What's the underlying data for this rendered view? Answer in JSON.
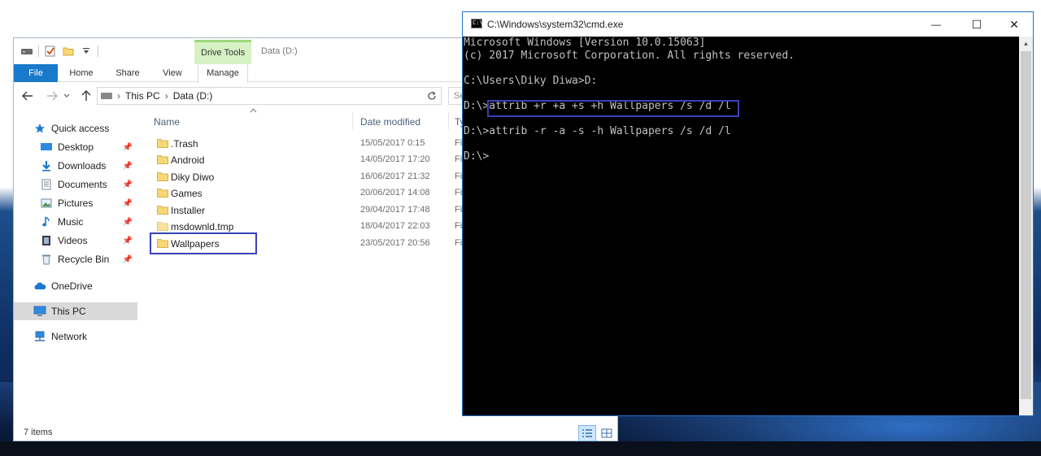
{
  "explorer": {
    "context_tab_group": "Drive Tools",
    "title": "Data (D:)",
    "tabs": {
      "file": "File",
      "home": "Home",
      "share": "Share",
      "view": "View",
      "manage": "Manage"
    },
    "breadcrumb": {
      "this_pc": "This PC",
      "drive": "Data (D:)",
      "separator": "›"
    },
    "search_placeholder": "Se",
    "nav_pane": {
      "quick_access": "Quick access",
      "items": [
        {
          "label": "Desktop",
          "icon": "desktop-icon",
          "pinned": true
        },
        {
          "label": "Downloads",
          "icon": "downloads-icon",
          "pinned": true
        },
        {
          "label": "Documents",
          "icon": "documents-icon",
          "pinned": true
        },
        {
          "label": "Pictures",
          "icon": "pictures-icon",
          "pinned": true
        },
        {
          "label": "Music",
          "icon": "music-icon",
          "pinned": true
        },
        {
          "label": "Videos",
          "icon": "videos-icon",
          "pinned": true
        },
        {
          "label": "Recycle Bin",
          "icon": "recycle-bin-icon",
          "pinned": true
        }
      ],
      "onedrive": "OneDrive",
      "this_pc": "This PC",
      "network": "Network"
    },
    "columns": {
      "name": "Name",
      "date_modified": "Date modified",
      "type": "Ty"
    },
    "files": [
      {
        "name": ".Trash",
        "date": "15/05/2017 0:15",
        "type": "Fi",
        "icon": "folder-icon"
      },
      {
        "name": "Android",
        "date": "14/05/2017 17:20",
        "type": "Fi",
        "icon": "folder-icon"
      },
      {
        "name": "Diky Diwo",
        "date": "16/06/2017 21:32",
        "type": "Fi",
        "icon": "folder-icon"
      },
      {
        "name": "Games",
        "date": "20/06/2017 14:08",
        "type": "Fi",
        "icon": "folder-icon"
      },
      {
        "name": "Installer",
        "date": "29/04/2017 17:48",
        "type": "Fi",
        "icon": "folder-icon"
      },
      {
        "name": "msdownld.tmp",
        "date": "18/04/2017 22:03",
        "type": "Fi",
        "icon": "folder-icon"
      },
      {
        "name": "Wallpapers",
        "date": "23/05/2017 20:56",
        "type": "Fi",
        "icon": "folder-icon"
      }
    ],
    "status": "7 items",
    "colors": {
      "file_tab": "#1979ca",
      "drive_tools": "#d6f2c5",
      "selection": "#cce8ff",
      "annotation": "#3842b8",
      "folder": "#f8d775"
    }
  },
  "cmd": {
    "title": "C:\\Windows\\system32\\cmd.exe",
    "controls": {
      "minimize": "—",
      "maximize": "☐",
      "close": "✕"
    },
    "lines": [
      "Microsoft Windows [Version 10.0.15063]",
      "(c) 2017 Microsoft Corporation. All rights reserved.",
      "",
      "C:\\Users\\Diky Diwa>D:",
      "",
      "D:\\>attrib +r +a +s +h Wallpapers /s /d /l",
      "",
      "D:\\>attrib -r -a -s -h Wallpapers /s /d /l",
      "",
      "D:\\>"
    ],
    "colors": {
      "background": "#000000",
      "text": "#c0c0c0",
      "annotation": "#3842b8"
    }
  }
}
